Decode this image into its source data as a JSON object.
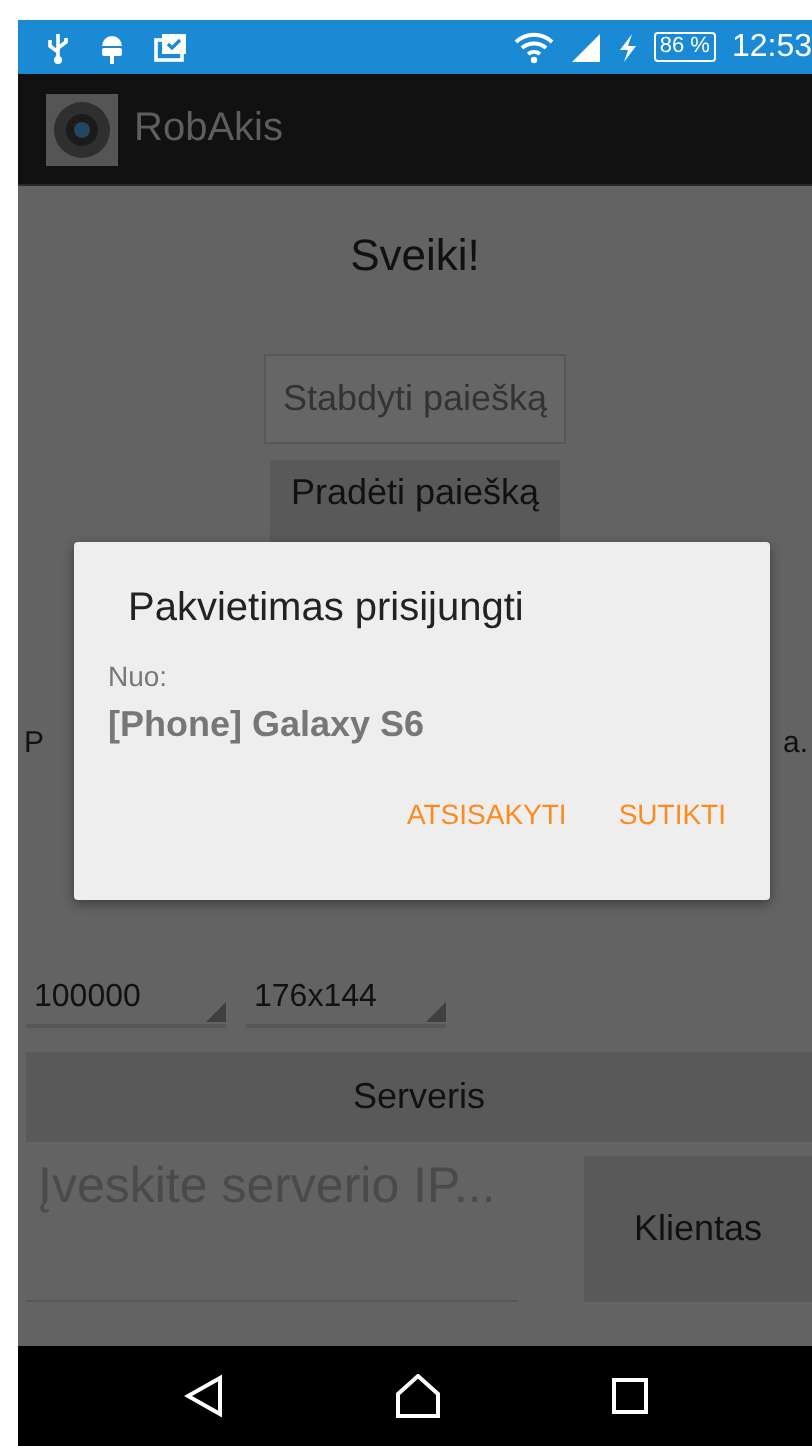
{
  "status_bar": {
    "battery": "86 %",
    "time": "12:53"
  },
  "app_bar": {
    "title": "RobAkis"
  },
  "main": {
    "greeting": "Sveiki!",
    "stop_button": {
      "label": "Stabdyti paiešką",
      "disabled": true
    },
    "start_button": {
      "label": "Pradėti paiešką",
      "disabled": false
    },
    "info_text_start": "P",
    "info_text_end": "a.",
    "spinners": [
      "100000",
      "176x144"
    ],
    "server_button": "Serveris",
    "ip_field": {
      "placeholder": "Įveskite serverio IP..."
    },
    "client_button": "Klientas"
  },
  "dialog": {
    "title": "Pakvietimas prisijungti",
    "from_label": "Nuo:",
    "device": "[Phone] Galaxy S6",
    "buttons": [
      "ATSISAKYTI",
      "SUTIKTI"
    ]
  }
}
